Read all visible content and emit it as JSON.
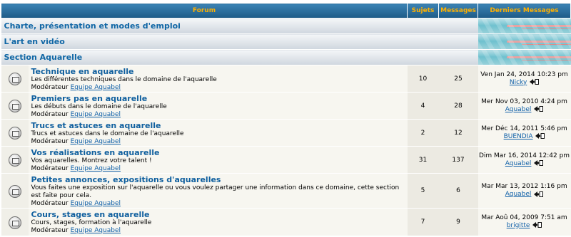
{
  "headers": {
    "forum": "Forum",
    "topics": "Sujets",
    "posts": "Messages",
    "last_posts": "Derniers Messages"
  },
  "categories": [
    {
      "title": "Charte, présentation et modes d'emploi"
    },
    {
      "title": "L'art en vidéo"
    },
    {
      "title": "Section Aquarelle"
    }
  ],
  "moderator_label": "Modérateur",
  "forums": [
    {
      "name": "Technique en aquarelle",
      "description": "Les différentes techniques dans le domaine de l'aquarelle",
      "moderator": "Equipe Aquabel",
      "topics": "10",
      "posts": "25",
      "last_date": "Ven Jan 24, 2014 10:23 pm",
      "last_user": "Nicky"
    },
    {
      "name": "Premiers pas en aquarelle",
      "description": "Les débuts dans le domaine de l'aquarelle",
      "moderator": "Equipe Aquabel",
      "topics": "4",
      "posts": "28",
      "last_date": "Mer Nov 03, 2010 4:24 pm",
      "last_user": "Aquabel"
    },
    {
      "name": "Trucs et astuces en aquarelle",
      "description": "Trucs et astuces dans le domaine de l'aquarelle",
      "moderator": "Equipe Aquabel",
      "topics": "2",
      "posts": "12",
      "last_date": "Mer Déc 14, 2011 5:46 pm",
      "last_user": "BUENDIA"
    },
    {
      "name": "Vos réalisations en aquarelle",
      "description": "Vos aquarelles. Montrez votre talent !",
      "moderator": "Equipe Aquabel",
      "topics": "31",
      "posts": "137",
      "last_date": "Dim Mar 16, 2014 12:42 pm",
      "last_user": "Aquabel"
    },
    {
      "name": "Petites annonces, expositions d'aquarelles",
      "description": "Vous faites une exposition sur l'aquarelle ou vous voulez partager une information dans ce domaine, cette section est faite pour cela.",
      "moderator": "Equipe Aquabel",
      "topics": "5",
      "posts": "6",
      "last_date": "Mar Mar 13, 2012 1:16 pm",
      "last_user": "Aquabel"
    },
    {
      "name": "Cours, stages en aquarelle",
      "description": "Cours, stages, formation à l'aquarelle",
      "moderator": "Equipe Aquabel",
      "topics": "7",
      "posts": "9",
      "last_date": "Mar Aoû 04, 2009 7:51 am",
      "last_user": "brigitte"
    }
  ],
  "colors": {
    "header_bg": "#2a6f9f",
    "header_text": "#ffb000",
    "link": "#0f5f9e"
  }
}
